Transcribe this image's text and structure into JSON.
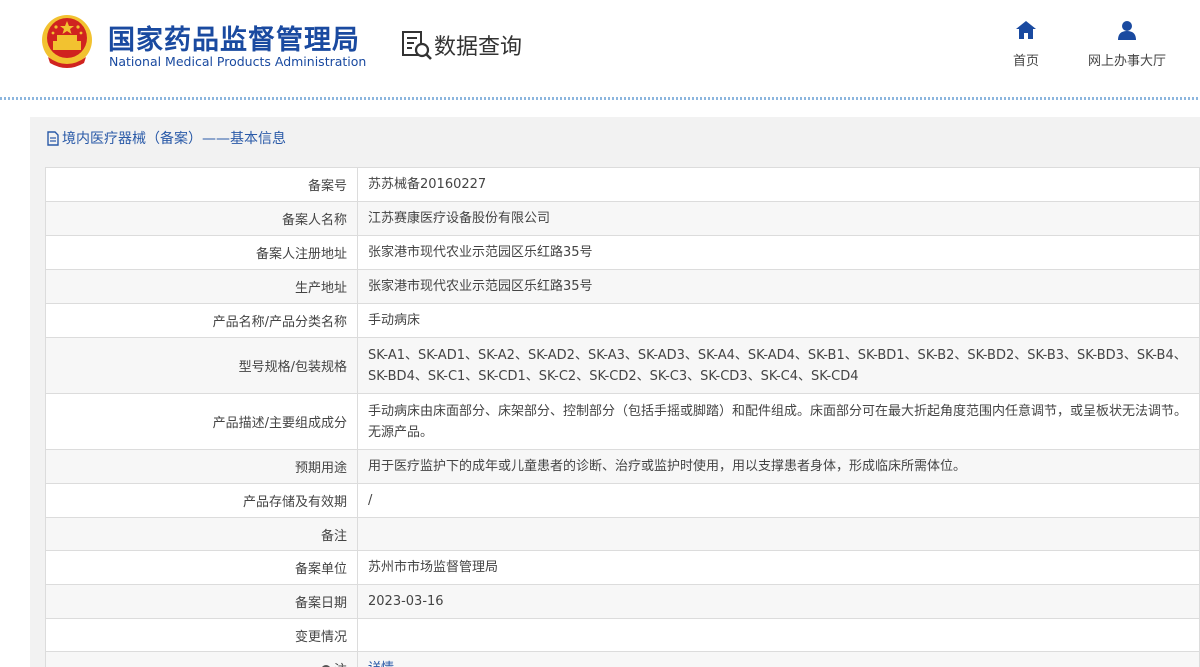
{
  "header": {
    "brand_cn": "国家药品监督管理局",
    "brand_en": "National Medical Products Administration",
    "query_label": "数据查询",
    "nav": [
      {
        "label": "首页",
        "icon": "home-icon"
      },
      {
        "label": "网上办事大厅",
        "icon": "user-icon"
      }
    ],
    "colors": {
      "brand": "#1a4aa0",
      "link": "#2a5aa8",
      "emblem_red": "#d0231f",
      "emblem_gold": "#f2c230"
    }
  },
  "panel": {
    "title": "境内医疗器械（备案）——基本信息"
  },
  "records": [
    {
      "label": "备案号",
      "value": "苏苏械备20160227"
    },
    {
      "label": "备案人名称",
      "value": "江苏赛康医疗设备股份有限公司"
    },
    {
      "label": "备案人注册地址",
      "value": "张家港市现代农业示范园区乐红路35号"
    },
    {
      "label": "生产地址",
      "value": "张家港市现代农业示范园区乐红路35号"
    },
    {
      "label": "产品名称/产品分类名称",
      "value": "手动病床"
    },
    {
      "label": "型号规格/包装规格",
      "value": "SK-A1、SK-AD1、SK-A2、SK-AD2、SK-A3、SK-AD3、SK-A4、SK-AD4、SK-B1、SK-BD1、SK-B2、SK-BD2、SK-B3、SK-BD3、SK-B4、SK-BD4、SK-C1、SK-CD1、SK-C2、SK-CD2、SK-C3、SK-CD3、SK-C4、SK-CD4"
    },
    {
      "label": "产品描述/主要组成成分",
      "value": "手动病床由床面部分、床架部分、控制部分（包括手摇或脚踏）和配件组成。床面部分可在最大折起角度范围内任意调节，或呈板状无法调节。无源产品。"
    },
    {
      "label": "预期用途",
      "value": "用于医疗监护下的成年或儿童患者的诊断、治疗或监护时使用，用以支撑患者身体，形成临床所需体位。"
    },
    {
      "label": "产品存储及有效期",
      "value": "/"
    },
    {
      "label": "备注",
      "value": ""
    },
    {
      "label": "备案单位",
      "value": "苏州市市场监督管理局"
    },
    {
      "label": "备案日期",
      "value": "2023-03-16"
    },
    {
      "label": "变更情况",
      "value": ""
    },
    {
      "label": "注",
      "value": "详情"
    }
  ]
}
